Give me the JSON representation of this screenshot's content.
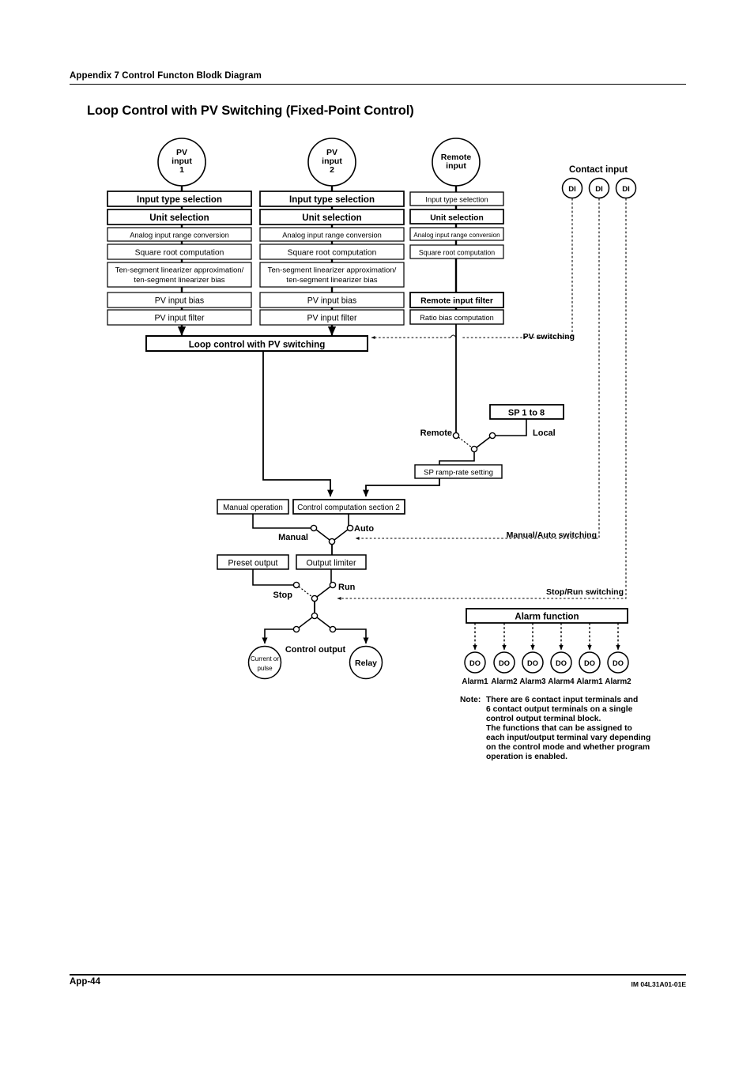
{
  "header": {
    "breadcrumb": "Appendix 7 Control Functon Blodk Diagram",
    "title": "Loop Control with PV Switching (Fixed-Point Control)"
  },
  "footer": {
    "page": "App-44",
    "doc_id": "IM 04L31A01-01E"
  },
  "diagram": {
    "sources": [
      {
        "id": "pv1",
        "lines": [
          "PV",
          "input",
          "1"
        ]
      },
      {
        "id": "pv2",
        "lines": [
          "PV",
          "input",
          "2"
        ]
      },
      {
        "id": "remote",
        "lines": [
          "Remote",
          "input"
        ]
      }
    ],
    "columns": [
      {
        "id": "pv1-chain",
        "blocks": [
          {
            "label": "Input type selection",
            "weight": "bold",
            "size": "large"
          },
          {
            "label": "Unit selection",
            "weight": "bold",
            "size": "large"
          },
          {
            "label": "Analog input range conversion",
            "weight": "normal",
            "size": "small"
          },
          {
            "label": "Square root computation",
            "weight": "normal",
            "size": "medium"
          },
          {
            "label": "Ten-segment linearizer approximation/",
            "label2": "ten-segment linearizer bias",
            "weight": "normal",
            "size": "medium"
          },
          {
            "label": "PV input bias",
            "weight": "normal",
            "size": "medium"
          },
          {
            "label": "PV input filter",
            "weight": "normal",
            "size": "medium"
          }
        ]
      },
      {
        "id": "pv2-chain",
        "blocks": [
          {
            "label": "Input type selection",
            "weight": "bold",
            "size": "large"
          },
          {
            "label": "Unit selection",
            "weight": "bold",
            "size": "large"
          },
          {
            "label": "Analog input range conversion",
            "weight": "normal",
            "size": "small"
          },
          {
            "label": "Square root computation",
            "weight": "normal",
            "size": "medium"
          },
          {
            "label": "Ten-segment linearizer approximation/",
            "label2": "ten-segment linearizer bias",
            "weight": "normal",
            "size": "medium"
          },
          {
            "label": "PV input bias",
            "weight": "normal",
            "size": "medium"
          },
          {
            "label": "PV input filter",
            "weight": "normal",
            "size": "medium"
          }
        ]
      },
      {
        "id": "remote-chain",
        "blocks": [
          {
            "label": "Input type selection",
            "weight": "normal",
            "size": "small"
          },
          {
            "label": "Unit selection",
            "weight": "bold",
            "size": "medium"
          },
          {
            "label": "Analog input range conversion",
            "weight": "normal",
            "size": "tiny"
          },
          {
            "label": "Square root computation",
            "weight": "normal",
            "size": "small"
          },
          {
            "label": "Remote input filter",
            "weight": "bold",
            "size": "medium"
          },
          {
            "label": "Ratio bias computation",
            "weight": "normal",
            "size": "small"
          }
        ]
      }
    ],
    "contact_input": {
      "label": "Contact input",
      "terminals": [
        "DI",
        "DI",
        "DI"
      ]
    },
    "blocks": {
      "loop_control": "Loop control with PV switching",
      "sp_1_to_8": "SP 1 to 8",
      "sp_ramp": "SP ramp-rate setting",
      "manual_operation": "Manual operation",
      "control_computation": "Control computation section 2",
      "preset_output": "Preset output",
      "output_limiter": "Output limiter",
      "alarm_function": "Alarm function"
    },
    "switch_labels": {
      "pv_switching": "PV switching",
      "remote": "Remote",
      "local": "Local",
      "manual": "Manual",
      "auto": "Auto",
      "manual_auto_switching": "Manual/Auto switching",
      "stop": "Stop",
      "run": "Run",
      "stop_run_switching": "Stop/Run switching",
      "control_output": "Control output"
    },
    "outputs": [
      {
        "id": "current-pulse",
        "lines": [
          "Current or",
          "pulse"
        ]
      },
      {
        "id": "relay",
        "lines": [
          "Relay"
        ]
      }
    ],
    "alarm_outputs": [
      {
        "terminal": "DO",
        "label": "Alarm1"
      },
      {
        "terminal": "DO",
        "label": "Alarm2"
      },
      {
        "terminal": "DO",
        "label": "Alarm3"
      },
      {
        "terminal": "DO",
        "label": "Alarm4"
      },
      {
        "terminal": "DO",
        "label": "Alarm1"
      },
      {
        "terminal": "DO",
        "label": "Alarm2"
      }
    ],
    "note": {
      "label": "Note:",
      "lines": [
        "There are 6 contact input terminals and",
        "6 contact output terminals on a single",
        "control output terminal block.",
        "The functions that can be assigned to",
        "each input/output terminal vary depending",
        "on the control mode and whether program",
        "operation is enabled."
      ]
    }
  }
}
